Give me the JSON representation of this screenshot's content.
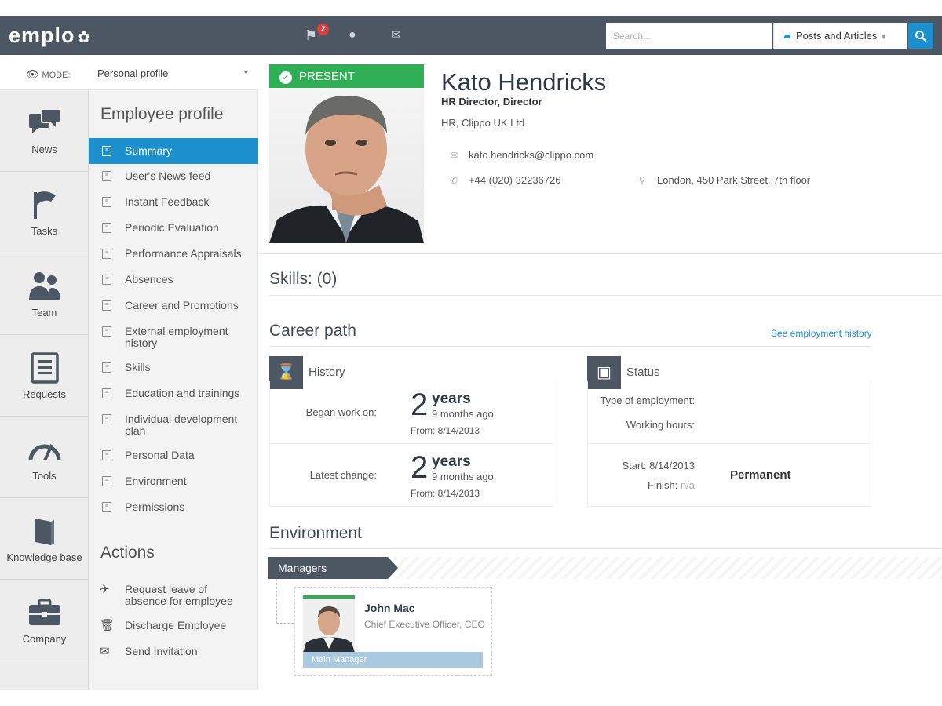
{
  "topbar": {
    "logo": "emplo",
    "notification_count": "2",
    "search_placeholder": "Search...",
    "search_scope": "Posts and Articles"
  },
  "mode": {
    "label": "MODE:",
    "value": "Personal profile"
  },
  "leftnav": {
    "items": [
      {
        "label": "News",
        "icon": "chat-bubbles-icon"
      },
      {
        "label": "Tasks",
        "icon": "flag-icon"
      },
      {
        "label": "Team",
        "icon": "people-icon"
      },
      {
        "label": "Requests",
        "icon": "document-icon"
      },
      {
        "label": "Tools",
        "icon": "gauge-icon"
      },
      {
        "label": "Knowledge base",
        "icon": "book-icon"
      },
      {
        "label": "Company",
        "icon": "briefcase-icon"
      }
    ]
  },
  "subnav": {
    "title": "Employee profile",
    "items": [
      "Summary",
      "User's News feed",
      "Instant Feedback",
      "Periodic Evaluation",
      "Performance Appraisals",
      "Absences",
      "Career and Promotions",
      "External employment history",
      "Skills",
      "Education and trainings",
      "Individual development plan",
      "Personal Data",
      "Environment",
      "Permissions"
    ],
    "actions_title": "Actions",
    "actions": [
      "Request leave of absence for employee",
      "Discharge Employee",
      "Send Invitation"
    ]
  },
  "profile": {
    "status": "PRESENT",
    "name": "Kato Hendricks",
    "title": "HR Director, Director",
    "company": "HR, Clippo UK Ltd",
    "email": "kato.hendricks@clippo.com",
    "phone": "+44 (020) 32236726",
    "address": "London, 450 Park Street, 7th floor"
  },
  "skills": {
    "title": "Skills: (0)"
  },
  "career": {
    "title": "Career path",
    "history_link": "See employment history",
    "history": {
      "label": "History",
      "began_label": "Began work on:",
      "began_num": "2",
      "began_unit": "years",
      "began_sub": "9 months ago",
      "began_from": "From: 8/14/2013",
      "latest_label": "Latest change:",
      "latest_num": "2",
      "latest_unit": "years",
      "latest_sub": "9 months ago",
      "latest_from": "From: 8/14/2013"
    },
    "status": {
      "label": "Status",
      "type_label": "Type of employment:",
      "hours_label": "Working hours:",
      "start": "Start: 8/14/2013",
      "finish_label": "Finish:",
      "finish_value": "n/a",
      "employment_type": "Permanent"
    }
  },
  "environment": {
    "title": "Environment",
    "managers_tab": "Managers",
    "manager": {
      "name": "John Mac",
      "role": "Chief Executive Officer, CEO",
      "badge": "Main Manager"
    }
  },
  "colors": {
    "topbar": "#4d5663",
    "accent_blue": "#1c8fce",
    "present_green": "#2fae55"
  }
}
